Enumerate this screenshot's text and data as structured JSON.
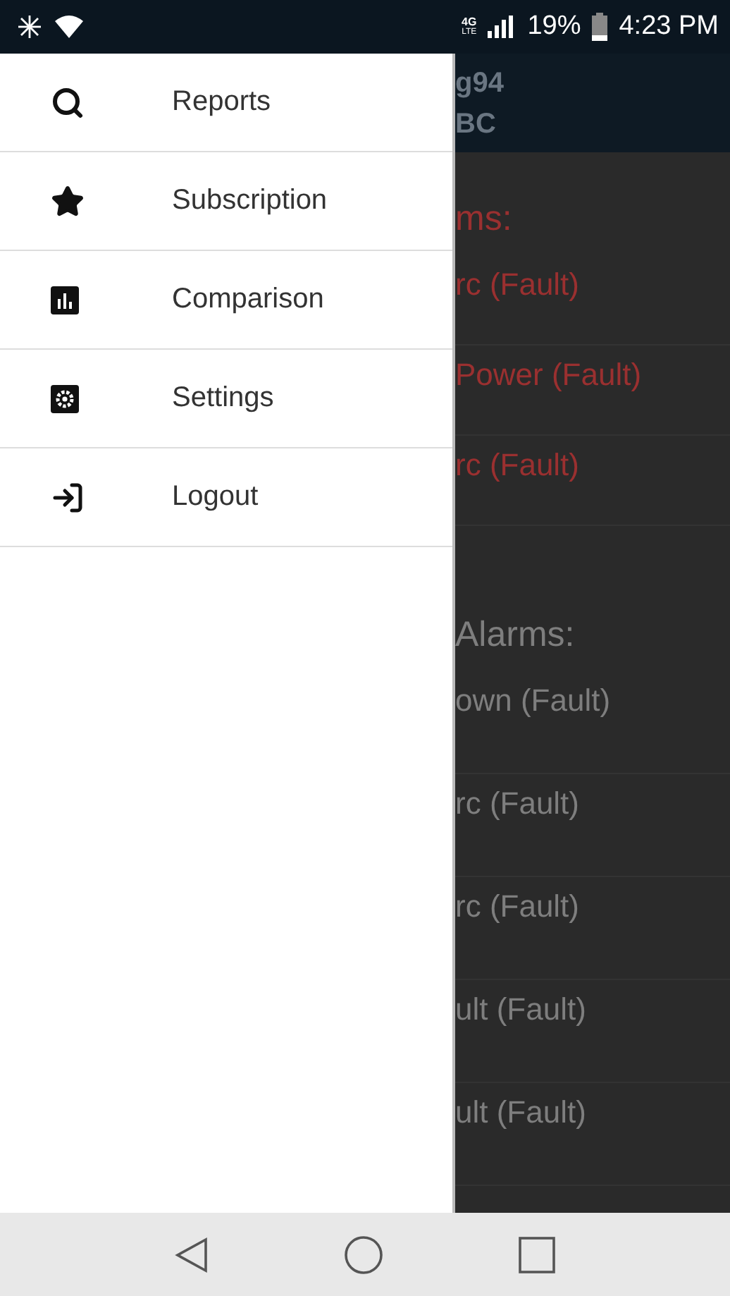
{
  "status_bar": {
    "network_top": "4G",
    "network_bottom": "LTE",
    "battery": "19%",
    "time": "4:23 PM"
  },
  "drawer": {
    "items": [
      {
        "label": "Reports",
        "kind": "search"
      },
      {
        "label": "Subscription",
        "kind": "star"
      },
      {
        "label": "Comparison",
        "kind": "chart"
      },
      {
        "label": "Settings",
        "kind": "settings"
      },
      {
        "label": "Logout",
        "kind": "logout"
      }
    ]
  },
  "background_screen": {
    "header": [
      "g94",
      "BC"
    ],
    "sections": [
      {
        "heading": "ms:",
        "kind": "fault",
        "rows": [
          "rc (Fault)",
          "Power (Fault)",
          "rc (Fault)"
        ]
      },
      {
        "heading": "Alarms:",
        "kind": "muted",
        "rows": [
          "own (Fault)",
          "rc (Fault)",
          "rc (Fault)",
          "ult (Fault)",
          "ult (Fault)"
        ]
      }
    ]
  }
}
